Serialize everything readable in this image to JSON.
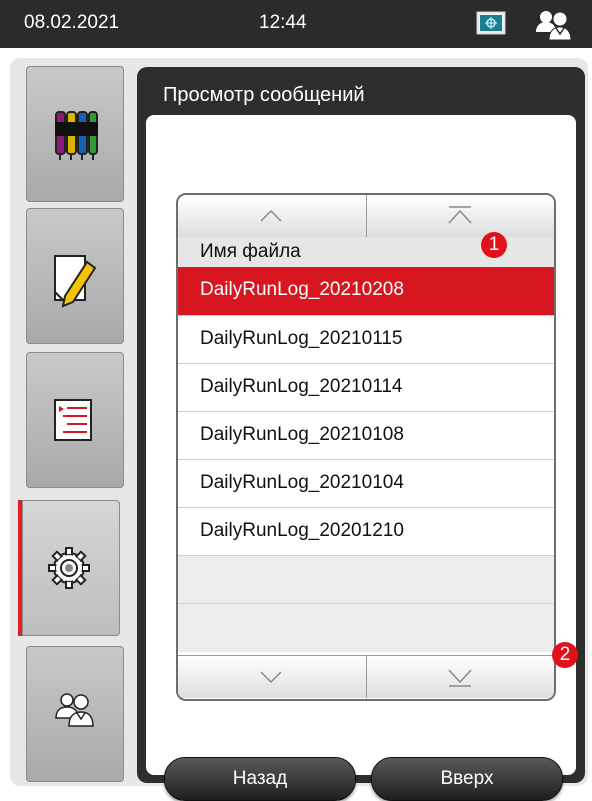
{
  "status_bar": {
    "date": "08.02.2021",
    "time": "12:44",
    "network_icon": "network-status-icon",
    "user_icon": "user-role-icon"
  },
  "sidebar": {
    "items": [
      {
        "name": "reagents",
        "icon": "reagent-bottles-icon"
      },
      {
        "name": "protocols",
        "icon": "protocol-edit-icon"
      },
      {
        "name": "station-status",
        "icon": "status-list-icon"
      },
      {
        "name": "settings",
        "icon": "gear-icon",
        "active": true
      },
      {
        "name": "user",
        "icon": "user-icon"
      }
    ],
    "active_color": "#e41e26"
  },
  "panel": {
    "title": "Просмотр сообщений",
    "list": {
      "column_header": "Имя файла",
      "files": [
        "DailyRunLog_20210208",
        "DailyRunLog_20210115",
        "DailyRunLog_20210114",
        "DailyRunLog_20210108",
        "DailyRunLog_20210104",
        "DailyRunLog_20201210"
      ],
      "selected_index": 0,
      "selected_color": "#d8161f"
    },
    "buttons": {
      "back": "Назад",
      "up": "Вверх"
    }
  },
  "callouts": [
    "1",
    "2"
  ]
}
